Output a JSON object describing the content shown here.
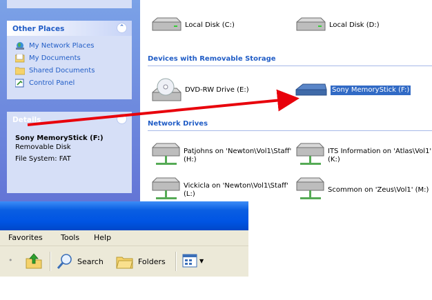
{
  "task_pane": {
    "other_places": {
      "title": "Other Places",
      "items": [
        {
          "label": "My Network Places",
          "icon": "network-places-icon"
        },
        {
          "label": "My Documents",
          "icon": "my-documents-icon"
        },
        {
          "label": "Shared Documents",
          "icon": "shared-documents-icon"
        },
        {
          "label": "Control Panel",
          "icon": "control-panel-icon"
        }
      ]
    },
    "details": {
      "title": "Details",
      "name": "Sony MemoryStick (F:)",
      "type": "Removable Disk",
      "filesystem": "File System: FAT"
    }
  },
  "content": {
    "hard_disks": [
      {
        "label": "Local Disk (C:)"
      },
      {
        "label": "Local Disk (D:)"
      }
    ],
    "removable_header": "Devices with Removable Storage",
    "removable": [
      {
        "label": "DVD-RW Drive (E:)"
      },
      {
        "label": "Sony MemoryStick (F:)",
        "selected": true
      }
    ],
    "network_header": "Network Drives",
    "network": [
      {
        "line1": "Patjohns on 'Newton\\Vol1\\Staff'",
        "line2": "(H:)"
      },
      {
        "line1": "ITS Information on 'Atlas\\Vol1'",
        "line2": "(K:)"
      },
      {
        "line1": "Vickicla on 'Newton\\Vol1\\Staff'",
        "line2": "(L:)"
      },
      {
        "line1": "Scommon on 'Zeus\\Vol1' (M:)",
        "line2": ""
      }
    ]
  },
  "window": {
    "menu": [
      "Favorites",
      "Tools",
      "Help"
    ],
    "toolbar": {
      "search_label": "Search",
      "folders_label": "Folders"
    }
  },
  "colors": {
    "taskpane_gradient_top": "#7ba2e7",
    "taskpane_gradient_bottom": "#6375d6",
    "link_blue": "#215dc6",
    "selection": "#316ac5",
    "arrow": "#e8000b",
    "titlebar": "#0054e3"
  }
}
